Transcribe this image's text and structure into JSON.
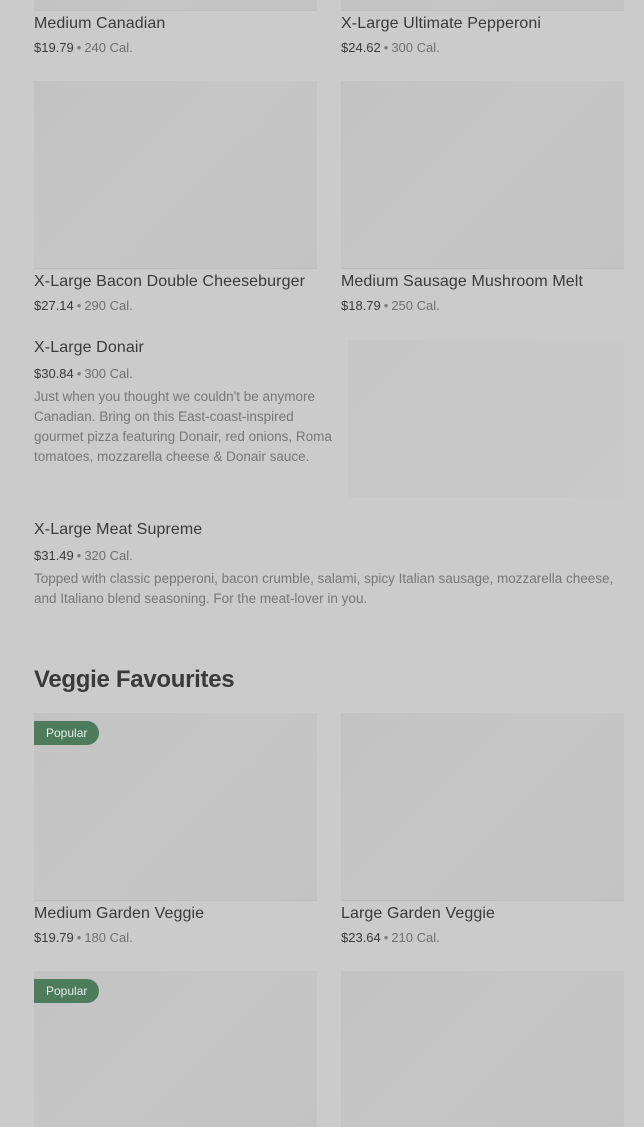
{
  "row0": {
    "left": {
      "name": "Medium Canadian",
      "price": "$19.79",
      "cal": "240 Cal."
    },
    "right": {
      "name": "X-Large Ultimate Pepperoni",
      "price": "$24.62",
      "cal": "300 Cal."
    }
  },
  "row1": {
    "left": {
      "name": "X-Large Bacon Double Cheeseburger",
      "price": "$27.14",
      "cal": "290 Cal."
    },
    "right": {
      "name": "Medium Sausage Mushroom Melt",
      "price": "$18.79",
      "cal": "250 Cal."
    }
  },
  "donair": {
    "name": "X-Large Donair",
    "price": "$30.84",
    "cal": "300 Cal.",
    "description": "Just when you thought we couldn't be anymore Canadian. Bring on this East-coast-inspired gourmet pizza featuring Donair, red onions, Roma tomatoes, mozzarella cheese & Donair sauce."
  },
  "meat_supreme": {
    "name": "X-Large Meat Supreme",
    "price": "$31.49",
    "cal": "320 Cal.",
    "description": "Topped with classic pepperoni, bacon crumble, salami, spicy Italian sausage, mozzarella cheese, and Italiano blend seasoning. For the meat-lover in you."
  },
  "veggie_section": {
    "title": "Veggie Favourites",
    "badge": "Popular",
    "left": {
      "name": "Medium Garden Veggie",
      "price": "$19.79",
      "cal": "180 Cal."
    },
    "right": {
      "name": "Large Garden Veggie",
      "price": "$23.64",
      "cal": "210 Cal."
    }
  },
  "separator": "•"
}
